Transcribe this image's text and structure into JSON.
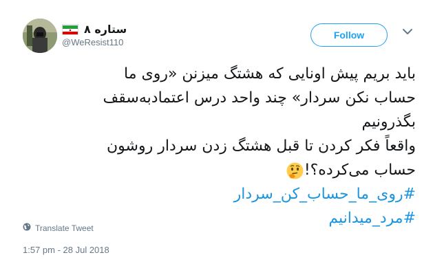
{
  "user": {
    "display_name": "ستاره ۸",
    "handle": "@WeResist110"
  },
  "follow_button": {
    "label": "Follow"
  },
  "tweet": {
    "line1": "باید بریم پیش اونایی که هشتگ میزنن «روی ما",
    "line2": "حساب نکن سردار» چند واحد درس اعتمادبه‌سقف",
    "line3": "بگذرونیم",
    "line4": "واقعاً فکر کردن تا قبل هشتگ زدن سردار روشون",
    "line5": "حساب می‌کرده؟!",
    "hashtag1": "#روی_ما_حساب_کن_سردار",
    "hashtag2": "#مرد_میدانیم"
  },
  "translate_label": "Translate Tweet",
  "timestamp": "1:57 pm - 28 Jul 2018",
  "colors": {
    "accent": "#1da1f2",
    "hashtag": "#1b95e0",
    "muted": "#657786",
    "text": "#14171a"
  },
  "icons": [
    "iran-flag-icon",
    "chevron-down-icon",
    "thinking-face-icon",
    "globe-icon"
  ]
}
